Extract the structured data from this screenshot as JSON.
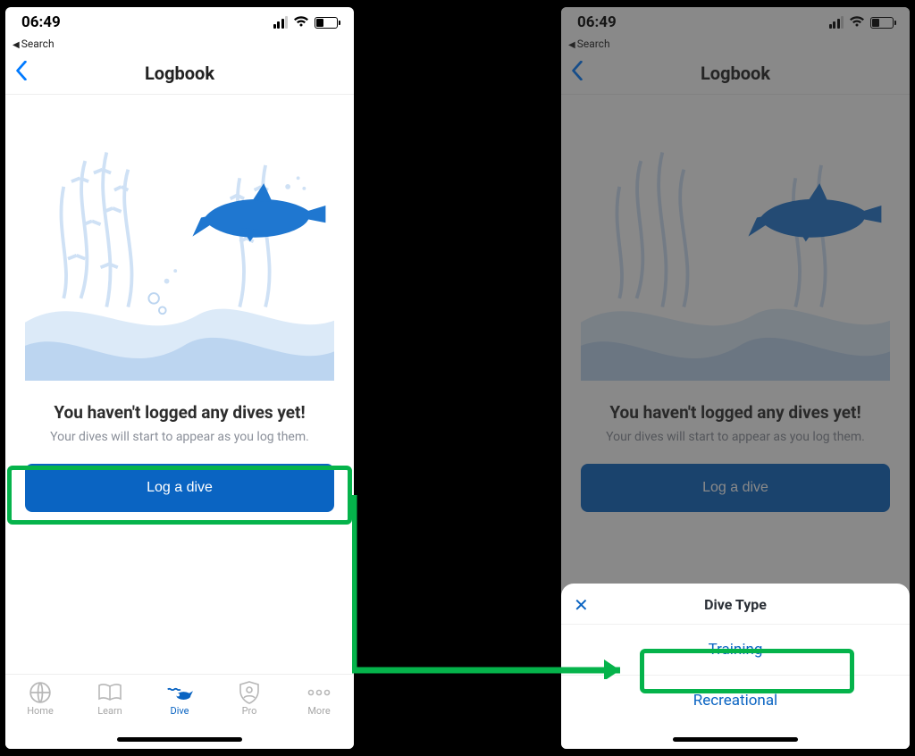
{
  "status": {
    "time": "06:49"
  },
  "breadcrumb": {
    "label": "Search"
  },
  "nav": {
    "title": "Logbook"
  },
  "empty": {
    "title": "You haven't logged any dives yet!",
    "subtitle": "Your dives will start to appear as you log them.",
    "cta": "Log a dive"
  },
  "tabs": {
    "home": "Home",
    "learn": "Learn",
    "dive": "Dive",
    "pro": "Pro",
    "more": "More"
  },
  "sheet": {
    "title": "Dive Type",
    "options": {
      "training": "Training",
      "recreational": "Recreational"
    }
  }
}
